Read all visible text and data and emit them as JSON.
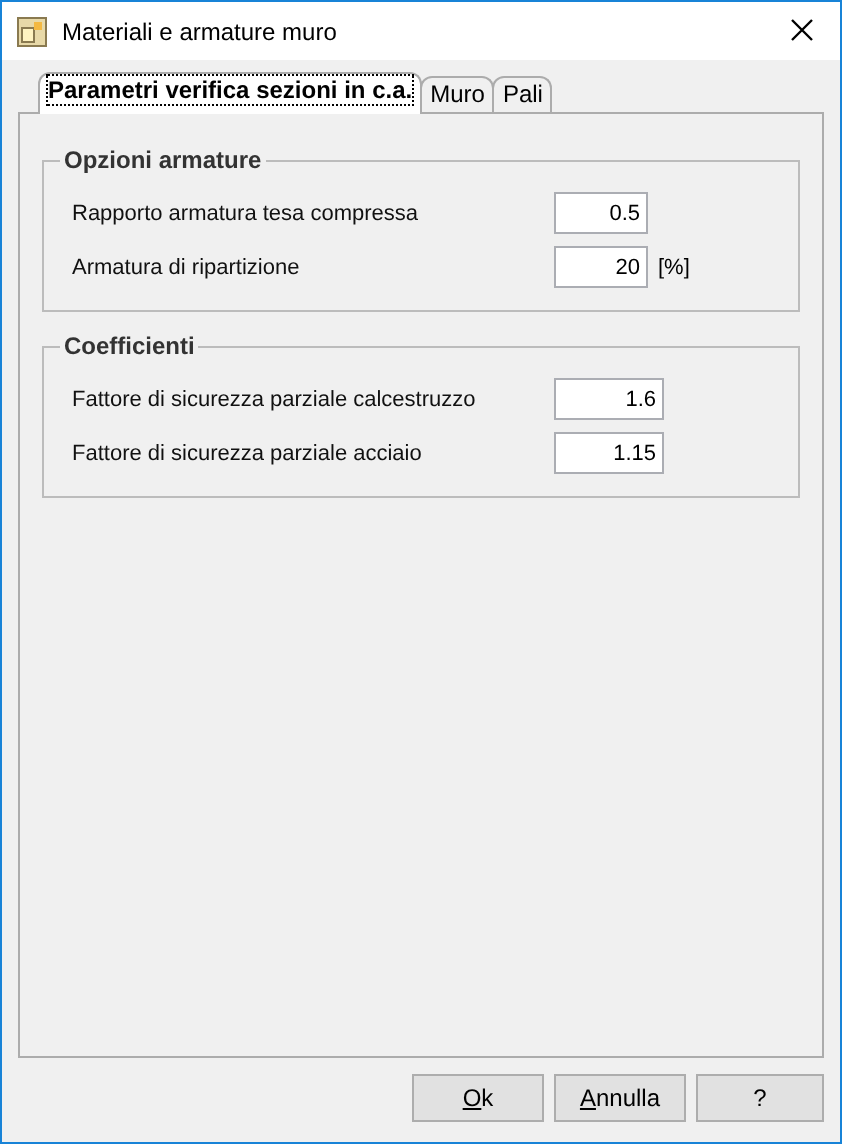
{
  "window": {
    "title": "Materiali e armature muro"
  },
  "tabs": [
    {
      "label": "Parametri verifica sezioni in c.a.",
      "selected": true
    },
    {
      "label": "Muro",
      "selected": false
    },
    {
      "label": "Pali",
      "selected": false
    }
  ],
  "groups": [
    {
      "title": "Opzioni armature",
      "fields": [
        {
          "label": "Rapporto armatura tesa compressa",
          "value": "0.5"
        },
        {
          "label": "Armatura di ripartizione",
          "value": "20",
          "unit": "[%]"
        }
      ]
    },
    {
      "title": "Coefficienti",
      "fields": [
        {
          "label": "Fattore di sicurezza parziale calcestruzzo",
          "value": "1.6"
        },
        {
          "label": "Fattore di sicurezza parziale acciaio",
          "value": "1.15"
        }
      ]
    }
  ],
  "buttons": [
    {
      "label": "Ok",
      "underline_first": true
    },
    {
      "label": "Annulla",
      "underline_first": true
    },
    {
      "label": "?"
    }
  ]
}
